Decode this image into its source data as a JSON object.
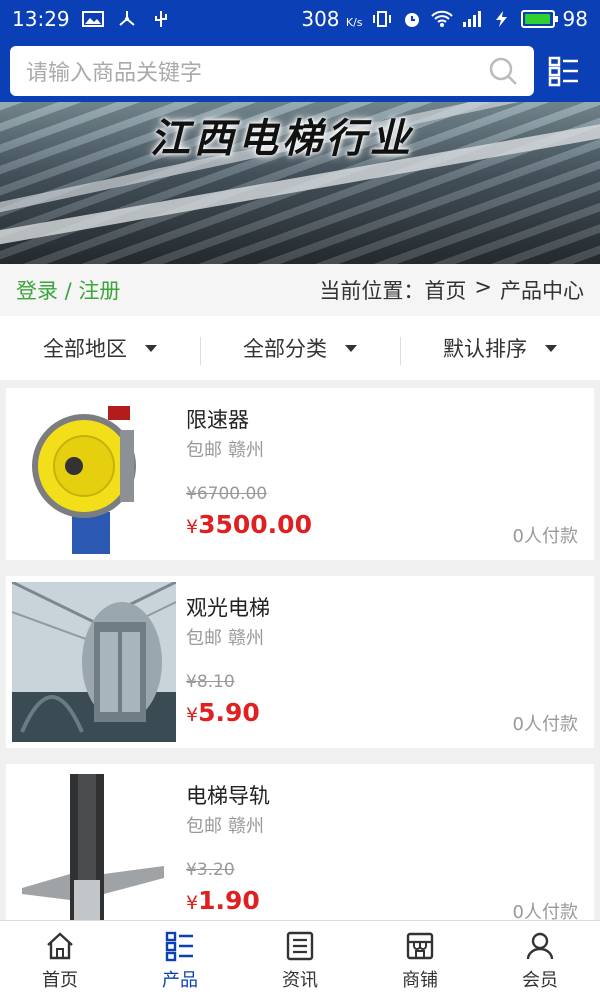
{
  "status": {
    "time": "13:29",
    "net_speed": "308",
    "net_unit": "K/s",
    "battery": "98",
    "battery_level": 0.98
  },
  "search": {
    "placeholder": "请输入商品关键字"
  },
  "banner": {
    "title": "江西电梯行业"
  },
  "login": {
    "text": "登录 / 注册"
  },
  "breadcrumb": {
    "label": "当前位置：",
    "home": "首页",
    "separator": ">",
    "current": "产品中心"
  },
  "filters": [
    {
      "label": "全部地区"
    },
    {
      "label": "全部分类"
    },
    {
      "label": "默认排序"
    }
  ],
  "products": [
    {
      "name": "限速器",
      "shipping": "包邮",
      "location": "赣州",
      "old_price": "¥6700.00",
      "currency": "¥",
      "price": "3500.00",
      "paid": "0人付款"
    },
    {
      "name": "观光电梯",
      "shipping": "包邮",
      "location": "赣州",
      "old_price": "¥8.10",
      "currency": "¥",
      "price": "5.90",
      "paid": "0人付款"
    },
    {
      "name": "电梯导轨",
      "shipping": "包邮",
      "location": "赣州",
      "old_price": "¥3.20",
      "currency": "¥",
      "price": "1.90",
      "paid": "0人付款"
    }
  ],
  "tabs": [
    {
      "label": "首页",
      "icon": "home-icon"
    },
    {
      "label": "产品",
      "icon": "product-list-icon",
      "active": true
    },
    {
      "label": "资讯",
      "icon": "news-icon"
    },
    {
      "label": "商铺",
      "icon": "shop-icon"
    },
    {
      "label": "会员",
      "icon": "member-icon"
    }
  ],
  "colors": {
    "brand": "#0b3fb5",
    "price": "#e02020",
    "login": "#3aa53a"
  }
}
